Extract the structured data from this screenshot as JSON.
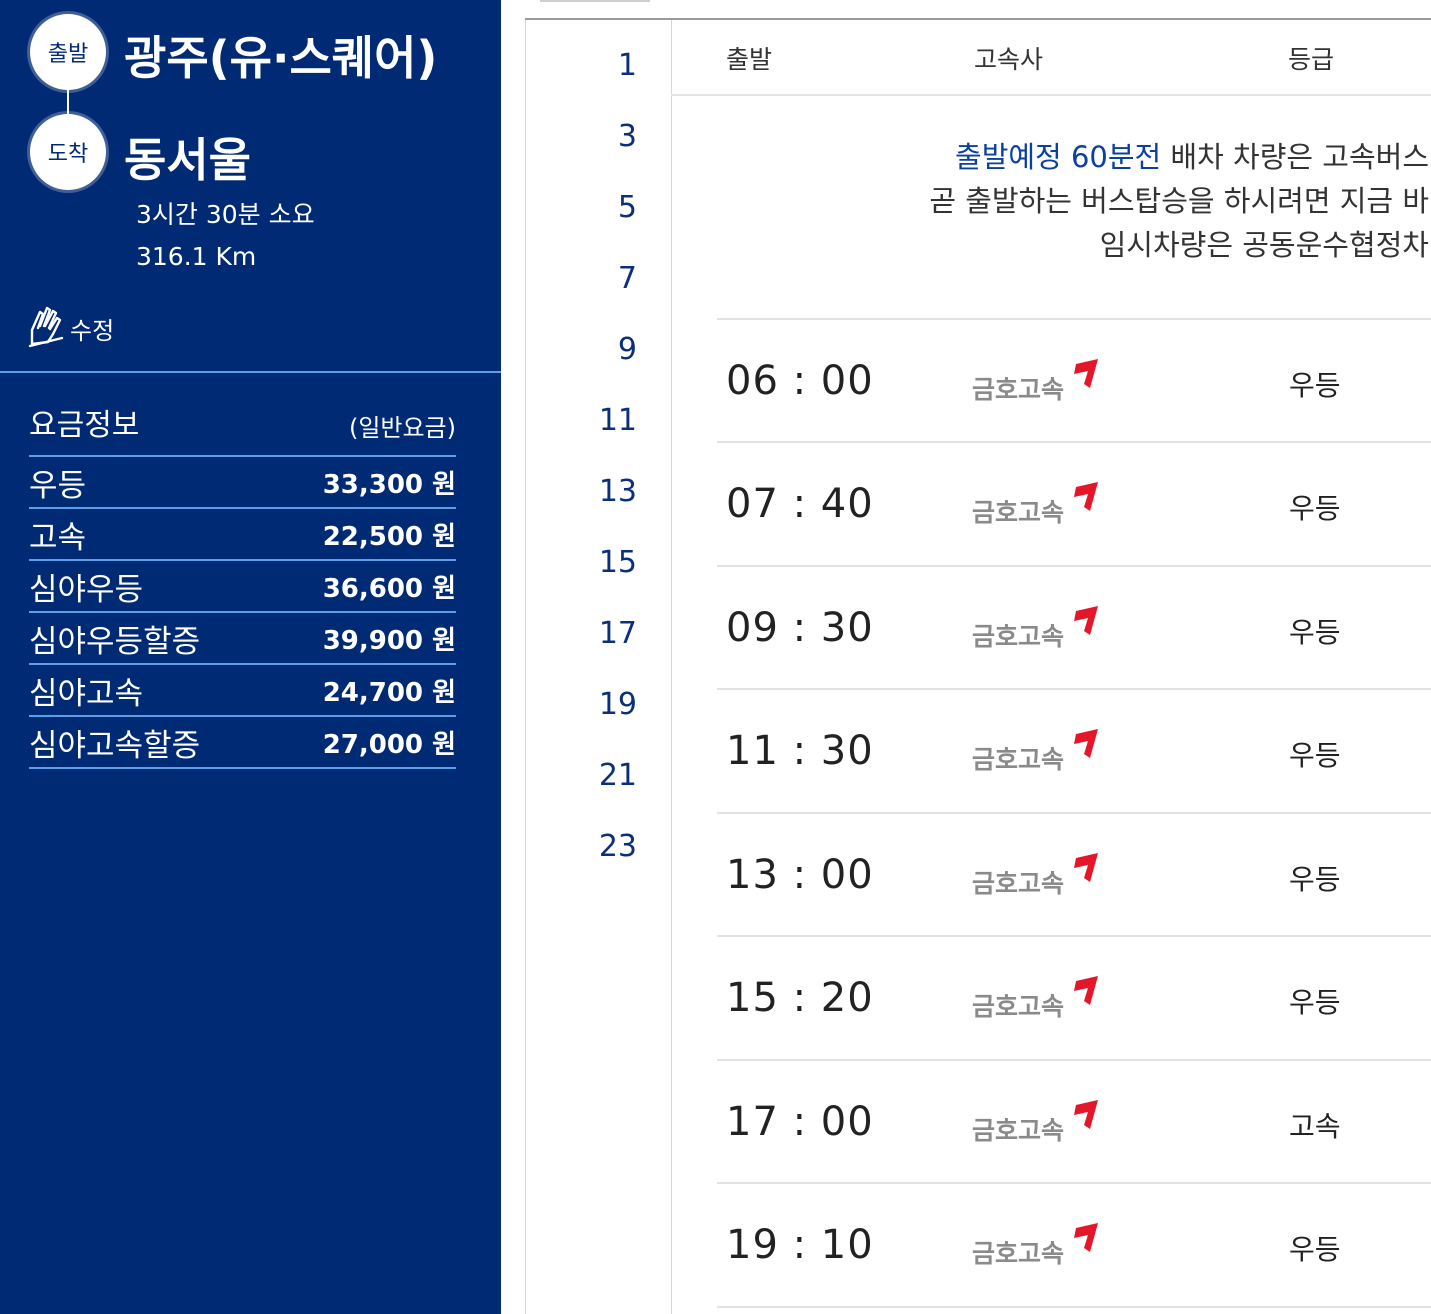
{
  "route": {
    "departure_badge": "출발",
    "departure_city": "광주(유·스퀘어)",
    "arrival_badge": "도착",
    "arrival_city": "동서울",
    "duration": "3시간 30분 소요",
    "distance": "316.1 Km",
    "edit_label": "수정",
    "edit_icon": "hand-edit-icon"
  },
  "fares": {
    "title": "요금정보",
    "note": "(일반요금)",
    "items": [
      {
        "name": "우등",
        "price": "33,300 원"
      },
      {
        "name": "고속",
        "price": "22,500 원"
      },
      {
        "name": "심야우등",
        "price": "36,600 원"
      },
      {
        "name": "심야우등할증",
        "price": "39,900 원"
      },
      {
        "name": "심야고속",
        "price": "24,700 원"
      },
      {
        "name": "심야고속할증",
        "price": "27,000 원"
      }
    ]
  },
  "hours": [
    "1",
    "3",
    "5",
    "7",
    "9",
    "11",
    "13",
    "15",
    "17",
    "19",
    "21",
    "23"
  ],
  "table": {
    "headers": {
      "departure": "출발",
      "company": "고속사",
      "grade": "등급"
    },
    "notice": {
      "line1_highlight": "출발예정 60분전",
      "line1_rest": " 배차 차량은 고속버스",
      "line2": "곧 출발하는 버스탑승을 하시려면 지금 바",
      "line3": "임시차량은 공동운수협정차"
    },
    "rows": [
      {
        "time": "06 : 00",
        "company": "금호고속",
        "grade": "우등"
      },
      {
        "time": "07 : 40",
        "company": "금호고속",
        "grade": "우등"
      },
      {
        "time": "09 : 30",
        "company": "금호고속",
        "grade": "우등"
      },
      {
        "time": "11 : 30",
        "company": "금호고속",
        "grade": "우등"
      },
      {
        "time": "13 : 00",
        "company": "금호고속",
        "grade": "우등"
      },
      {
        "time": "15 : 20",
        "company": "금호고속",
        "grade": "우등"
      },
      {
        "time": "17 : 00",
        "company": "금호고속",
        "grade": "고속"
      },
      {
        "time": "19 : 10",
        "company": "금호고속",
        "grade": "우등"
      }
    ]
  },
  "colors": {
    "panel": "#002a73",
    "accent_line": "#5c9ee8",
    "hour_text": "#0b2f7a",
    "logo_red": "#e4162a",
    "logo_gray": "#8a8a8a"
  }
}
